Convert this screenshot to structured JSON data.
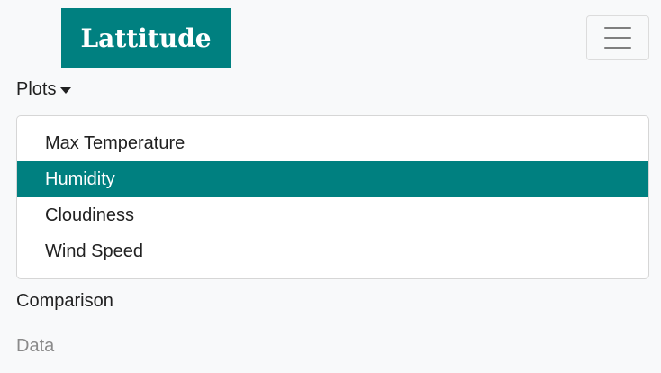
{
  "brand": {
    "title": "Lattitude"
  },
  "navbar": {
    "toggler_icon": "hamburger-menu-icon"
  },
  "nav": {
    "plots_label": "Plots",
    "plots_items": [
      {
        "label": "Max Temperature",
        "active": false
      },
      {
        "label": "Humidity",
        "active": true
      },
      {
        "label": "Cloudiness",
        "active": false
      },
      {
        "label": "Wind Speed",
        "active": false
      }
    ],
    "comparison_label": "Comparison",
    "data_label": "Data"
  },
  "colors": {
    "accent": "#008080",
    "background": "#f8f9fa",
    "muted_text": "#8a8a8a"
  }
}
